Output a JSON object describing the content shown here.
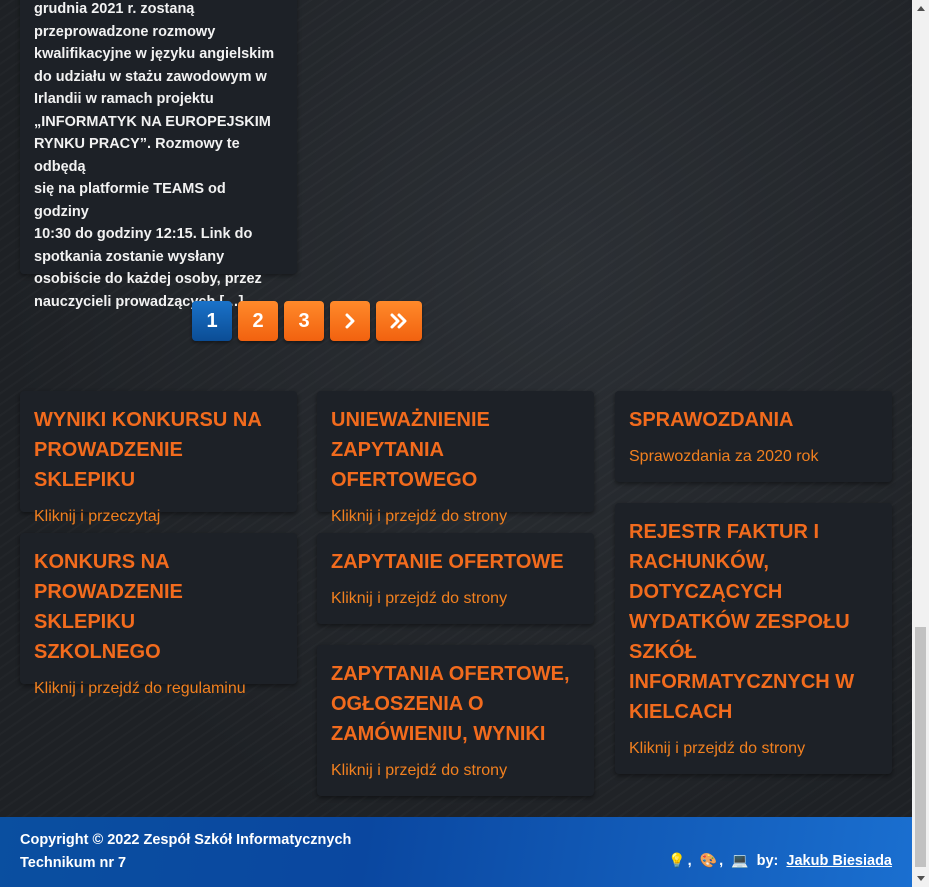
{
  "post": {
    "excerpt_lines": [
      "grudnia 2021 r. zostaną",
      "przeprowadzone rozmowy",
      "kwalifikacyjne w języku angielskim",
      "do udziału w stażu zawodowym w",
      "Irlandii w ramach projektu",
      "„INFORMATYK NA EUROPEJSKIM",
      "RYNKU PRACY”. Rozmowy te odbędą",
      "się na platformie TEAMS od godziny",
      "10:30 do godziny 12:15. Link do",
      "spotkania zostanie wysłany",
      "osobiście do każdej osoby, przez",
      "nauczycieli prowadzących […]"
    ]
  },
  "pagination": {
    "pages": [
      "1",
      "2",
      "3"
    ],
    "current": "1",
    "next_icon": "chevron-right-icon",
    "last_icon": "double-chevron-right-icon"
  },
  "cards": {
    "wyniki": {
      "title_lines": [
        "WYNIKI KONKURSU NA",
        "PROWADZENIE SKLEPIKU"
      ],
      "link": "Kliknij i przeczytaj"
    },
    "konkurs": {
      "title_lines": [
        "KONKURS NA",
        "PROWADZENIE SKLEPIKU",
        "SZKOLNEGO"
      ],
      "link": "Kliknij i przejdź do regulaminu"
    },
    "uniewaznienie": {
      "title_lines": [
        "UNIEWAŻNIENIE",
        "ZAPYTANIA OFERTOWEGO"
      ],
      "link": "Kliknij i przejdź do strony"
    },
    "zapytanie": {
      "title_lines": [
        "ZAPYTANIE OFERTOWE"
      ],
      "link": "Kliknij i przejdź do strony"
    },
    "zapytania": {
      "title_lines": [
        "ZAPYTANIA OFERTOWE,",
        "OGŁOSZENIA O",
        "ZAMÓWIENIU, WYNIKI"
      ],
      "link": "Kliknij i przejdź do strony"
    },
    "sprawozdania": {
      "title_lines": [
        "SPRAWOZDANIA"
      ],
      "link": "Sprawozdania za 2020 rok"
    },
    "rejestr": {
      "title_lines": [
        "REJESTR FAKTUR I",
        "RACHUNKÓW,",
        "DOTYCZĄCYCH",
        "WYDATKÓW ZESPOŁU",
        "SZKÓŁ",
        "INFORMATYCZNYCH W",
        "KIELCACH"
      ],
      "link": "Kliknij i przejdź do strony"
    }
  },
  "footer": {
    "copyright_line1": "Copyright © 2022 Zespół Szkół Informatycznych",
    "copyright_line2": "Technikum nr 7",
    "emoji_bulb": "💡",
    "emoji_palette": "🎨",
    "emoji_laptop": "💻",
    "comma": ",",
    "by_label": "by:",
    "author": "Jakub Biesiada"
  },
  "colors": {
    "accent_orange": "#f26b1d",
    "active_page_blue": "#0b4d95",
    "card_bg": "#1d2127",
    "footer_blue": "#0a4fa0"
  }
}
